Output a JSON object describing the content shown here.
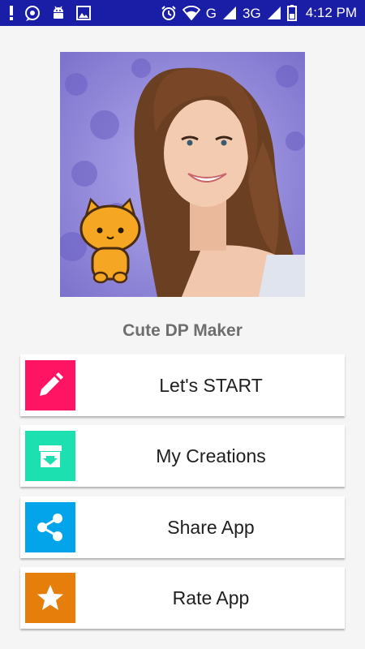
{
  "status_bar": {
    "network_label": "G",
    "network2_label": "3G",
    "time": "4:12 PM",
    "left_icons": [
      "exclamation-icon",
      "chat-settings-icon",
      "android-icon",
      "image-icon"
    ],
    "right_icons": [
      "alarm-icon",
      "wifi-icon",
      "signal-icon",
      "battery-icon"
    ]
  },
  "app": {
    "title": "Cute DP Maker"
  },
  "menu": [
    {
      "label": "Let's START",
      "icon": "pencil-icon",
      "color": "#ff1464"
    },
    {
      "label": "My Creations",
      "icon": "archive-download-icon",
      "color": "#1de0b0"
    },
    {
      "label": "Share App",
      "icon": "share-icon",
      "color": "#03a4ea"
    },
    {
      "label": "Rate App",
      "icon": "star-icon",
      "color": "#e67e0c"
    }
  ],
  "colors": {
    "status_bar": "#1a1da6",
    "background": "#f5f5f5",
    "title_text": "#6e6e6e"
  }
}
